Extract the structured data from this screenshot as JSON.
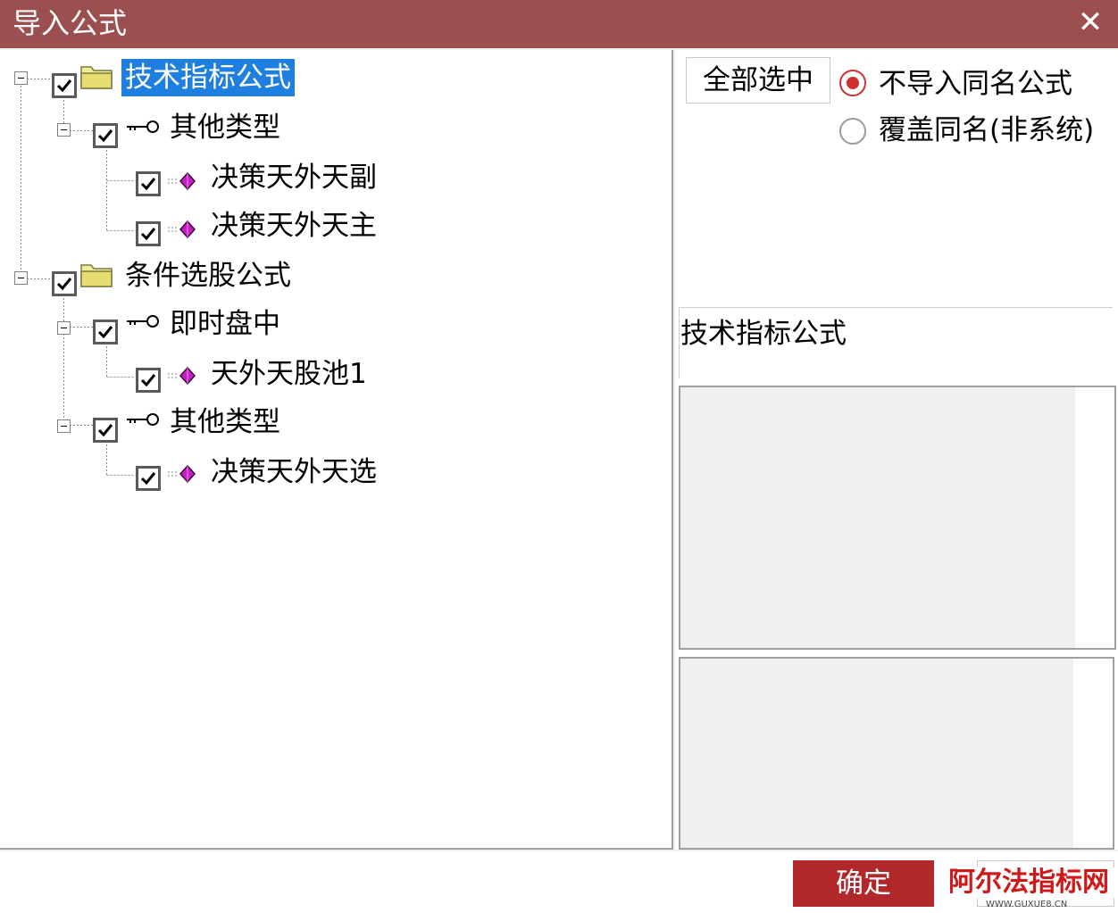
{
  "window": {
    "title": "导入公式",
    "close_glyph": "✕"
  },
  "tree": {
    "nodes": [
      {
        "label": "技术指标公式",
        "icon": "folder-icon",
        "checked": true,
        "selected": true
      },
      {
        "label": "其他类型",
        "icon": "key-icon",
        "checked": true
      },
      {
        "label": "决策天外天副",
        "icon": "formula-gem-icon",
        "checked": true
      },
      {
        "label": "决策天外天主",
        "icon": "formula-gem-icon",
        "checked": true
      },
      {
        "label": "条件选股公式",
        "icon": "folder-icon",
        "checked": true
      },
      {
        "label": "即时盘中",
        "icon": "key-icon",
        "checked": true
      },
      {
        "label": "天外天股池1",
        "icon": "formula-gem-icon",
        "checked": true
      },
      {
        "label": "其他类型",
        "icon": "key-icon",
        "checked": true
      },
      {
        "label": "决策天外天选",
        "icon": "formula-gem-icon",
        "checked": true
      }
    ]
  },
  "options": {
    "select_all_label": "全部选中",
    "radio_no_import_label": "不导入同名公式",
    "radio_overwrite_label": "覆盖同名(非系统)",
    "selected_option": "不导入同名公式"
  },
  "detail": {
    "name": "技术指标公式"
  },
  "footer": {
    "ok_label": "确定"
  },
  "watermark": {
    "main": "阿尔法指标网",
    "sub": "WWW.GUXUE8.CN"
  },
  "colors": {
    "titlebar": "#9b4f4f",
    "selection": "#1e7fe0",
    "ok_button": "#b0282a",
    "radio_accent": "#d03030",
    "gem": "#c020c0"
  }
}
